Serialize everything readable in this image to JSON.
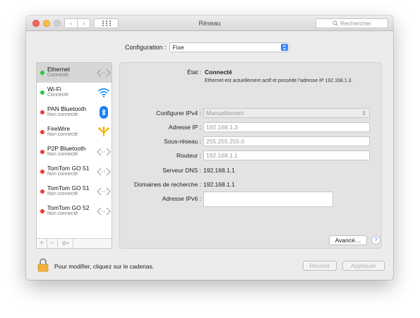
{
  "window": {
    "title": "Réseau"
  },
  "search": {
    "placeholder": "Rechercher"
  },
  "configuration": {
    "label": "Configuration :",
    "value": "Fixe"
  },
  "services": [
    {
      "name": "Ethernet",
      "status": "Connecté",
      "dot": "green",
      "icon": "ethernet-icon"
    },
    {
      "name": "Wi-Fi",
      "status": "Connecté",
      "dot": "green",
      "icon": "wifi-icon"
    },
    {
      "name": "PAN Bluetooth",
      "status": "Non connecté",
      "dot": "red",
      "icon": "bluetooth-icon"
    },
    {
      "name": "FireWire",
      "status": "Non connecté",
      "dot": "red",
      "icon": "firewire-icon"
    },
    {
      "name": "P2P Bluetooth",
      "status": "Non connecté",
      "dot": "red",
      "icon": "ethernet-icon"
    },
    {
      "name": "TomTom GO 51",
      "status": "Non connecté",
      "dot": "red",
      "icon": "ethernet-icon"
    },
    {
      "name": "TomTom GO 51",
      "status": "Non connecté",
      "dot": "red",
      "icon": "ethernet-icon"
    },
    {
      "name": "TomTom GO 52",
      "status": "Non connecté",
      "dot": "red",
      "icon": "ethernet-icon"
    }
  ],
  "sidebar_footer": {
    "add": "+",
    "remove": "−",
    "action": "⚙"
  },
  "detail": {
    "state_label": "État :",
    "state_value": "Connecté",
    "state_desc": "Ethernet est actuellement actif et possède l'adresse IP 192.168.1.3.",
    "ipv4_label": "Configurer IPv4 :",
    "ipv4_value": "Manuellement",
    "ip_label": "Adresse IP :",
    "ip_value": "192.168.1.3",
    "subnet_label": "Sous-réseau :",
    "subnet_value": "255.255.255.0",
    "router_label": "Routeur :",
    "router_value": "192.168.1.1",
    "dns_label": "Serveur DNS :",
    "dns_value": "192.168.1.1",
    "domains_label": "Domaines de recherche :",
    "domains_value": "192.168.1.1",
    "ipv6_label": "Adresse IPv6 :",
    "ipv6_value": ""
  },
  "buttons": {
    "advanced": "Avancé…",
    "help": "?",
    "revert": "Revenir",
    "apply": "Appliquer"
  },
  "footer": {
    "lock_text": "Pour modifier, cliquez sur le cadenas."
  },
  "colors": {
    "accent": "#3b82f6",
    "connected": "#28c840",
    "disconnected": "#ee3b37",
    "wifi": "#1e8cf0",
    "firewire": "#f2b400"
  }
}
